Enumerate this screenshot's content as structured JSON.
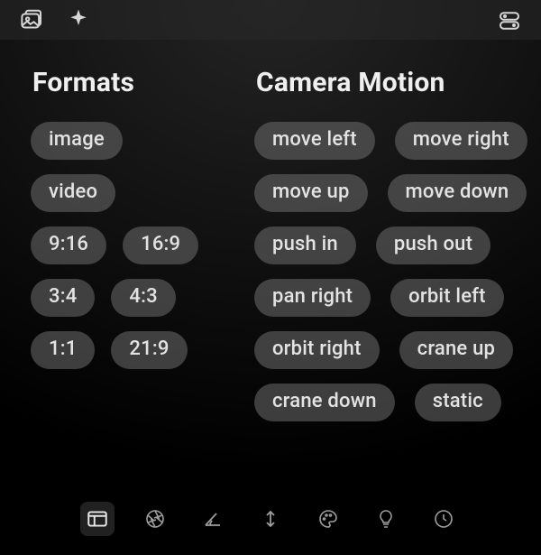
{
  "topbar": {
    "gallery_icon": "gallery",
    "sparkle_icon": "sparkle",
    "settings_icon": "settings-toggle"
  },
  "formats": {
    "title": "Formats",
    "rows": [
      [
        "image"
      ],
      [
        "video"
      ],
      [
        "9:16",
        "16:9"
      ],
      [
        "3:4",
        "4:3"
      ],
      [
        "1:1",
        "21:9"
      ]
    ]
  },
  "camera_motion": {
    "title": "Camera Motion",
    "rows": [
      [
        "move left",
        "move right"
      ],
      [
        "move up",
        "move down"
      ],
      [
        "push in",
        "push out"
      ],
      [
        "pan right",
        "orbit left"
      ],
      [
        "orbit right",
        "crane up"
      ],
      [
        "crane down",
        "static"
      ]
    ]
  },
  "bottom_nav": {
    "items": [
      {
        "name": "layout",
        "active": true
      },
      {
        "name": "aperture",
        "active": false
      },
      {
        "name": "angle",
        "active": false
      },
      {
        "name": "vertical",
        "active": false
      },
      {
        "name": "palette",
        "active": false
      },
      {
        "name": "bulb",
        "active": false
      },
      {
        "name": "clock",
        "active": false
      }
    ]
  }
}
